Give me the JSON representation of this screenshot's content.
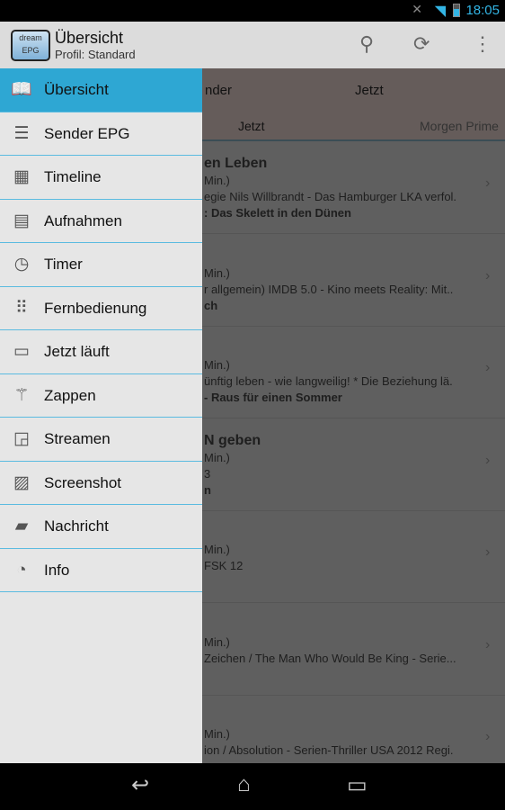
{
  "status": {
    "time": "18:05",
    "icons": [
      "mute-icon",
      "wifi-icon",
      "battery-icon"
    ]
  },
  "actionbar": {
    "logo_top": "dream",
    "logo_bottom": "EPG",
    "title": "Übersicht",
    "subtitle": "Profil: Standard",
    "icons": [
      "search-icon",
      "refresh-icon",
      "overflow-icon"
    ]
  },
  "filters": {
    "sender": "nder",
    "time": "Jetzt"
  },
  "tabs": [
    {
      "label": "Jetzt"
    },
    {
      "label": "Morgen Prime"
    }
  ],
  "rows": [
    {
      "title": "en Leben",
      "duration": "Min.)",
      "desc": "egie Nils Willbrandt - Das Hamburger LKA verfol.",
      "bold": ": Das Skelett in den Dünen"
    },
    {
      "title": "",
      "duration": "Min.)",
      "desc": "r allgemein) IMDB 5.0 - Kino meets Reality: Mit..",
      "bold": "ch"
    },
    {
      "title": "",
      "duration": "Min.)",
      "desc": "ünftig leben - wie langweilig!  * Die Beziehung lä.",
      "bold": "- Raus für einen Sommer"
    },
    {
      "title": "N geben",
      "duration": "Min.)",
      "desc": "3",
      "bold": "n"
    },
    {
      "title": "",
      "duration": "Min.)",
      "desc": "FSK 12",
      "bold": ""
    },
    {
      "title": "",
      "duration": "Min.)",
      "desc": "Zeichen / The Man Who Would Be King - Serie...",
      "bold": ""
    },
    {
      "title": "",
      "duration": "Min.)",
      "desc": "ion / Absolution - Serien-Thriller USA 2012 Regi.",
      "bold": ""
    }
  ],
  "drawer": {
    "accent": "#2ea7d3",
    "items": [
      {
        "label": "Übersicht",
        "icon": "book-icon",
        "active": true
      },
      {
        "label": "Sender EPG",
        "icon": "list-icon"
      },
      {
        "label": "Timeline",
        "icon": "calendar-icon"
      },
      {
        "label": "Aufnahmen",
        "icon": "film-icon"
      },
      {
        "label": "Timer",
        "icon": "clock-icon"
      },
      {
        "label": "Fernbedienung",
        "icon": "keypad-icon"
      },
      {
        "label": "Jetzt läuft",
        "icon": "monitor-icon"
      },
      {
        "label": "Zappen",
        "icon": "magic-wand-icon"
      },
      {
        "label": "Streamen",
        "icon": "cast-icon"
      },
      {
        "label": "Screenshot",
        "icon": "image-icon"
      },
      {
        "label": "Nachricht",
        "icon": "chat-icon"
      },
      {
        "label": "Info",
        "icon": "pie-chart-icon"
      }
    ]
  }
}
